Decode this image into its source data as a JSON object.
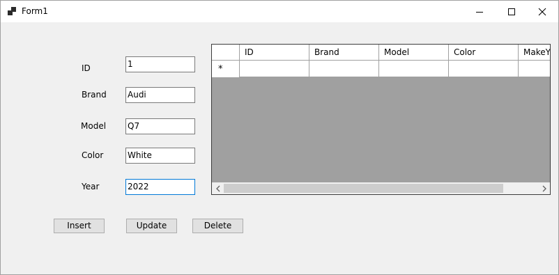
{
  "window": {
    "title": "Form1",
    "icon": "app-form-icon",
    "controls": [
      "minimize-icon",
      "maximize-icon",
      "close-icon"
    ]
  },
  "form": {
    "id_label": "ID",
    "id_value": "1",
    "brand_label": "Brand",
    "brand_value": "Audi",
    "model_label": "Model",
    "model_value": "Q7",
    "color_label": "Color",
    "color_value": "White",
    "year_label": "Year",
    "year_value": "2022"
  },
  "grid": {
    "columns": [
      "ID",
      "Brand",
      "Model",
      "Color",
      "MakeYear"
    ],
    "new_row_marker": "*"
  },
  "buttons": {
    "insert": "Insert",
    "update": "Update",
    "delete": "Delete"
  },
  "colors": {
    "focus_border": "#0078d7",
    "grid_background": "#a0a0a0",
    "form_background": "#f0f0f0"
  }
}
